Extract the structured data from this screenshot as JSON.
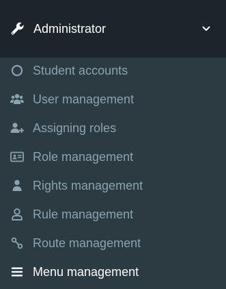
{
  "menu": {
    "header": {
      "icon": "wrench-icon",
      "label": "Administrator",
      "expanded_indicator": "chevron-down-icon"
    },
    "items": [
      {
        "label": "Student accounts",
        "icon": "circle-outline-icon",
        "active": false
      },
      {
        "label": "User management",
        "icon": "users-icon",
        "active": false
      },
      {
        "label": "Assigning roles",
        "icon": "user-plus-icon",
        "active": false
      },
      {
        "label": "Role management",
        "icon": "id-card-icon",
        "active": false
      },
      {
        "label": "Rights management",
        "icon": "user-icon",
        "active": false
      },
      {
        "label": "Rule management",
        "icon": "user-outline-icon",
        "active": false
      },
      {
        "label": "Route management",
        "icon": "route-icon",
        "active": false
      },
      {
        "label": "Menu management",
        "icon": "bars-icon",
        "active": true
      }
    ]
  },
  "colors": {
    "sidebar_bg": "#2c3b41",
    "header_bg": "#1c2529",
    "item_text": "#8aa4af",
    "active_text": "#ffffff"
  }
}
